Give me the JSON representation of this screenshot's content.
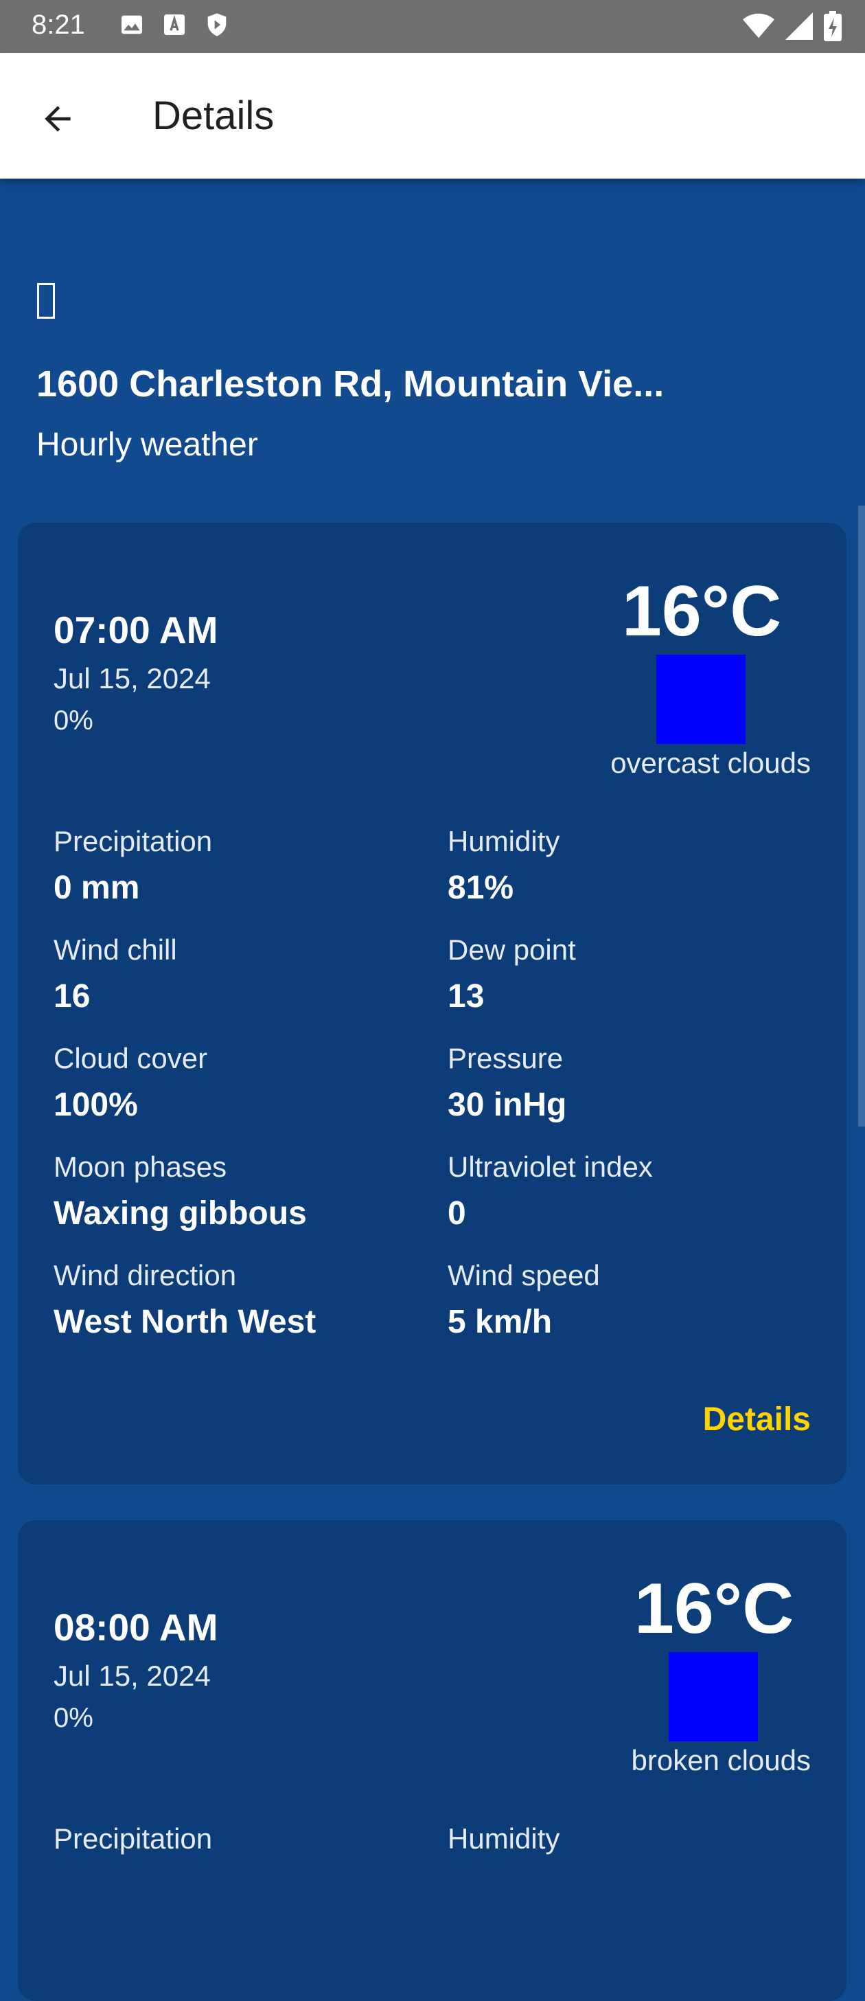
{
  "status_bar": {
    "time": "8:21",
    "icons_left": [
      "image-icon",
      "font-download-icon",
      "shield-play-icon"
    ],
    "icons_right": [
      "wifi-icon",
      "signal-icon",
      "battery-icon"
    ]
  },
  "app_bar": {
    "back_icon": "arrow-left-icon",
    "title": "Details"
  },
  "header": {
    "icon": "missing-glyph-icon",
    "location": "1600 Charleston Rd, Mountain Vie...",
    "subtitle": "Hourly weather"
  },
  "colors": {
    "background": "#114a8f",
    "card": "#0d3d78",
    "accent": "#ffd400",
    "weather_icon_placeholder": "#0000ff"
  },
  "cards": [
    {
      "time": "07:00 AM",
      "date": "Jul 15, 2024",
      "precip_chance": "0%",
      "temp": "16°C",
      "condition": "overcast clouds",
      "metrics": [
        {
          "label": "Precipitation",
          "value": "0 mm"
        },
        {
          "label": "Humidity",
          "value": "81%"
        },
        {
          "label": "Wind chill",
          "value": "16"
        },
        {
          "label": "Dew point",
          "value": "13"
        },
        {
          "label": "Cloud cover",
          "value": "100%"
        },
        {
          "label": "Pressure",
          "value": "30 inHg"
        },
        {
          "label": "Moon phases",
          "value": "Waxing gibbous"
        },
        {
          "label": "Ultraviolet index",
          "value": "0"
        },
        {
          "label": "Wind direction",
          "value": "West North West"
        },
        {
          "label": "Wind speed",
          "value": "5 km/h"
        }
      ],
      "details_label": "Details"
    },
    {
      "time": "08:00 AM",
      "date": "Jul 15, 2024",
      "precip_chance": "0%",
      "temp": "16°C",
      "condition": "broken clouds",
      "metrics": [
        {
          "label": "Precipitation",
          "value": ""
        },
        {
          "label": "Humidity",
          "value": ""
        }
      ]
    }
  ]
}
